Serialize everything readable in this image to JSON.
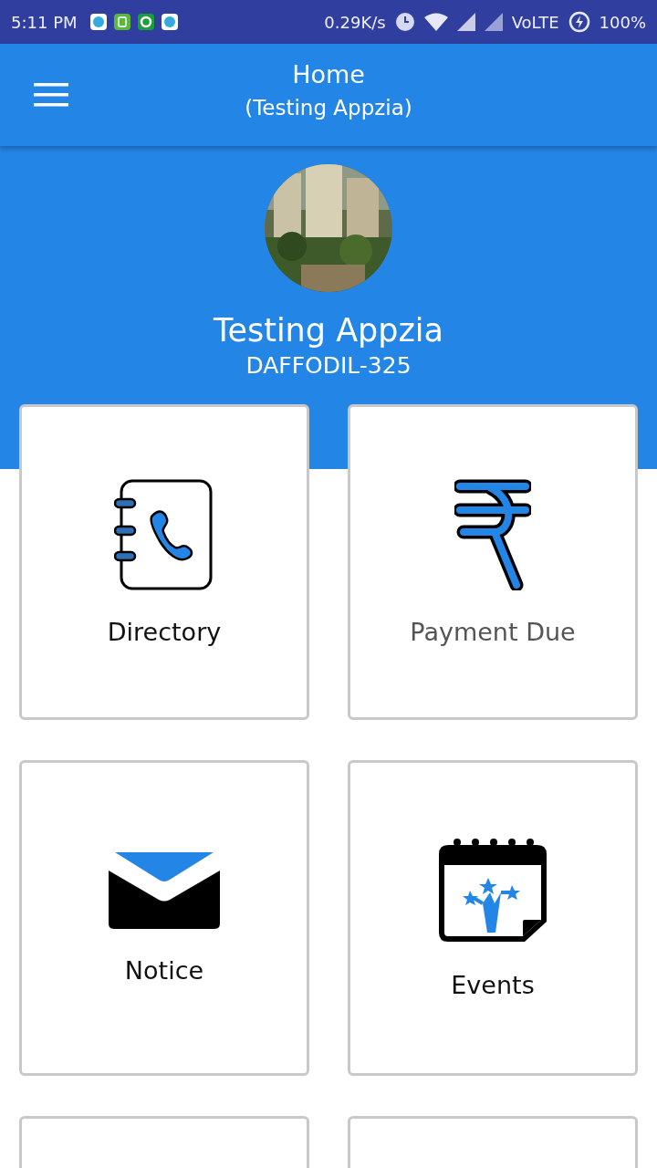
{
  "status_bar": {
    "time": "5:11 PM",
    "speed": "0.29K/s",
    "network": "VoLTE",
    "battery": "100%"
  },
  "app_bar": {
    "title": "Home",
    "subtitle": "(Testing Appzia)"
  },
  "profile": {
    "name": "Testing Appzia",
    "unit": "DAFFODIL-325"
  },
  "tiles": [
    {
      "kind": "directory",
      "label": "Directory",
      "muted": false
    },
    {
      "kind": "payment",
      "label": "Payment Due",
      "muted": true
    },
    {
      "kind": "notice",
      "label": "Notice",
      "muted": false
    },
    {
      "kind": "events",
      "label": "Events",
      "muted": false
    },
    {
      "kind": "empty"
    },
    {
      "kind": "empty"
    }
  ]
}
